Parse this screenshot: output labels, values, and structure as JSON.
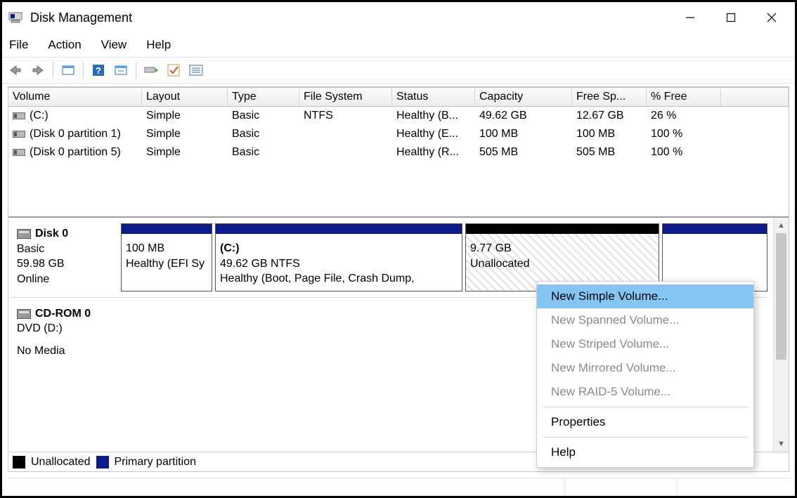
{
  "window": {
    "title": "Disk Management"
  },
  "menu": {
    "file": "File",
    "action": "Action",
    "view": "View",
    "help": "Help"
  },
  "table": {
    "headers": {
      "volume": "Volume",
      "layout": "Layout",
      "type": "Type",
      "fs": "File System",
      "status": "Status",
      "capacity": "Capacity",
      "free": "Free Sp...",
      "pctfree": "% Free"
    },
    "rows": [
      {
        "volume": "(C:)",
        "layout": "Simple",
        "type": "Basic",
        "fs": "NTFS",
        "status": "Healthy (B...",
        "capacity": "49.62 GB",
        "free": "12.67 GB",
        "pctfree": "26 %"
      },
      {
        "volume": "(Disk 0 partition 1)",
        "layout": "Simple",
        "type": "Basic",
        "fs": "",
        "status": "Healthy (E...",
        "capacity": "100 MB",
        "free": "100 MB",
        "pctfree": "100 %"
      },
      {
        "volume": "(Disk 0 partition 5)",
        "layout": "Simple",
        "type": "Basic",
        "fs": "",
        "status": "Healthy (R...",
        "capacity": "505 MB",
        "free": "505 MB",
        "pctfree": "100 %"
      }
    ]
  },
  "disks": {
    "disk0": {
      "title": "Disk 0",
      "subtype": "Basic",
      "size": "59.98 GB",
      "state": "Online",
      "part_efi": {
        "line1": "100 MB",
        "line2": "Healthy (EFI Sy"
      },
      "part_c": {
        "name": "(C:)",
        "line1": "49.62 GB NTFS",
        "line2": "Healthy (Boot, Page File, Crash Dump,"
      },
      "part_unalloc": {
        "line1": "9.77 GB",
        "line2": "Unallocated"
      },
      "part_recovery": {
        "line1": "",
        "line2": ""
      }
    },
    "cdrom": {
      "title": "CD-ROM 0",
      "subtype": "DVD (D:)",
      "nomedia": "No Media"
    }
  },
  "legend": {
    "unallocated": "Unallocated",
    "primary": "Primary partition"
  },
  "context_menu": {
    "simple": "New Simple Volume...",
    "spanned": "New Spanned Volume...",
    "striped": "New Striped Volume...",
    "mirrored": "New Mirrored Volume...",
    "raid5": "New RAID-5 Volume...",
    "properties": "Properties",
    "help": "Help"
  }
}
